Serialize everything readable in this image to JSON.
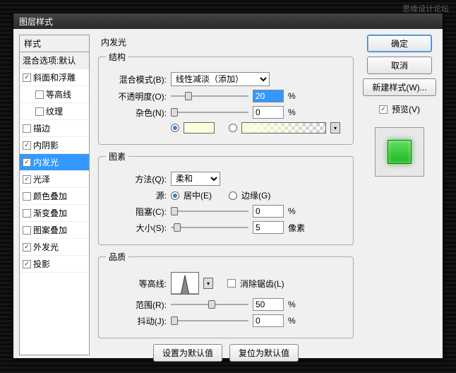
{
  "watermark": "思缘设计论坛",
  "dialog_title": "图层样式",
  "left": {
    "header": "样式",
    "first": "混合选项:默认",
    "items": [
      {
        "label": "斜面和浮雕",
        "checked": true,
        "indent": false
      },
      {
        "label": "等高线",
        "checked": false,
        "indent": true
      },
      {
        "label": "纹理",
        "checked": false,
        "indent": true
      },
      {
        "label": "描边",
        "checked": false,
        "indent": false
      },
      {
        "label": "内阴影",
        "checked": true,
        "indent": false
      },
      {
        "label": "内发光",
        "checked": true,
        "indent": false,
        "active": true
      },
      {
        "label": "光泽",
        "checked": true,
        "indent": false
      },
      {
        "label": "颜色叠加",
        "checked": false,
        "indent": false
      },
      {
        "label": "渐变叠加",
        "checked": false,
        "indent": false
      },
      {
        "label": "图案叠加",
        "checked": false,
        "indent": false
      },
      {
        "label": "外发光",
        "checked": true,
        "indent": false
      },
      {
        "label": "投影",
        "checked": true,
        "indent": false
      }
    ]
  },
  "center": {
    "title": "内发光",
    "group1": {
      "legend": "结构",
      "blend_label": "混合模式(B):",
      "blend_value": "线性减淡（添加）",
      "opacity_label": "不透明度(O):",
      "opacity_value": "20",
      "opacity_unit": "%",
      "noise_label": "杂色(N):",
      "noise_value": "0",
      "noise_unit": "%"
    },
    "group2": {
      "legend": "图素",
      "technique_label": "方法(Q):",
      "technique_value": "柔和",
      "source_label": "源:",
      "source_center": "居中(E)",
      "source_edge": "边缘(G)",
      "choke_label": "阻塞(C):",
      "choke_value": "0",
      "choke_unit": "%",
      "size_label": "大小(S):",
      "size_value": "5",
      "size_unit": "像素"
    },
    "group3": {
      "legend": "品质",
      "contour_label": "等高线:",
      "antialias_label": "消除锯齿(L)",
      "range_label": "范围(R):",
      "range_value": "50",
      "range_unit": "%",
      "jitter_label": "抖动(J):",
      "jitter_value": "0",
      "jitter_unit": "%"
    },
    "btn_default": "设置为默认值",
    "btn_reset": "复位为默认值"
  },
  "right": {
    "ok": "确定",
    "cancel": "取消",
    "newstyle": "新建样式(W)...",
    "preview": "预览(V)"
  }
}
